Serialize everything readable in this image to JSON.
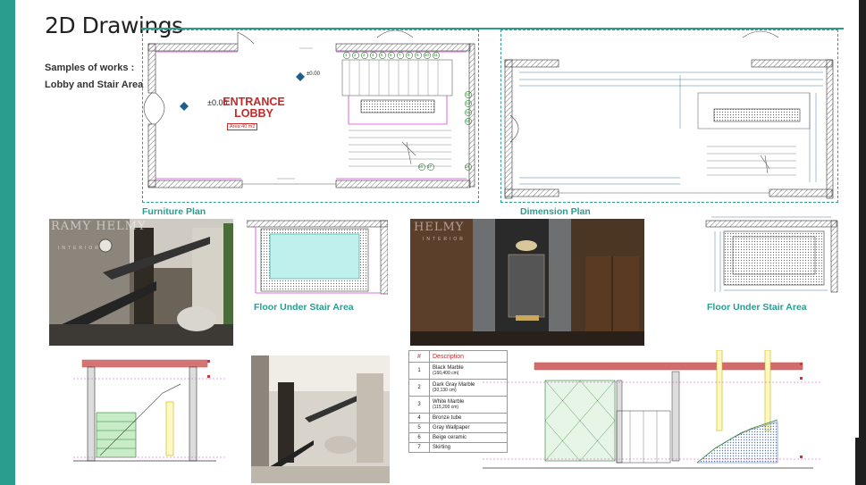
{
  "header": {
    "title": "2D Drawings",
    "subtitle_line1": "Samples of works :",
    "subtitle_line2": "Lobby and Stair Area"
  },
  "furniture_plan": {
    "caption": "Furniture Plan",
    "room_name_line1": "ENTRANCE",
    "room_name_line2": "LOBBY",
    "area_tag": "Area:40 m2",
    "level_a": "±0.00",
    "level_b": "±0.00",
    "stair_numbers": [
      "1",
      "2",
      "3",
      "4",
      "5",
      "6",
      "7",
      "8",
      "9",
      "10",
      "11",
      "12",
      "13",
      "14",
      "15",
      "16",
      "17",
      "18"
    ]
  },
  "dimension_plan": {
    "caption": "Dimension Plan"
  },
  "under_stair_plan_a": {
    "caption": "Floor Under Stair Area"
  },
  "under_stair_plan_b": {
    "caption": "Floor Under Stair Area"
  },
  "watermark": {
    "brand_a": "RAMY HELMY",
    "brand_b": "HELMY",
    "tag": "INTERIOR"
  },
  "materials_table": {
    "headers": [
      "#",
      "Description"
    ],
    "rows": [
      {
        "n": "1",
        "d": "Black Marble",
        "s": "(160,400 cm)"
      },
      {
        "n": "2",
        "d": "Dark Gray Marble",
        "s": "(30,130 cm)"
      },
      {
        "n": "3",
        "d": "White Marble",
        "s": "(115,200 cm)"
      },
      {
        "n": "4",
        "d": "Bronze tube",
        "s": ""
      },
      {
        "n": "5",
        "d": "Gray Wallpaper",
        "s": ""
      },
      {
        "n": "6",
        "d": "Beige ceramic",
        "s": ""
      },
      {
        "n": "7",
        "d": "Skirting",
        "s": ""
      }
    ]
  },
  "colors": {
    "accent": "#2a9d8f",
    "room_label": "#c62828",
    "table_header": "#c62828",
    "stair_marker": "#2e7d32",
    "magenta": "#d63fd6"
  }
}
